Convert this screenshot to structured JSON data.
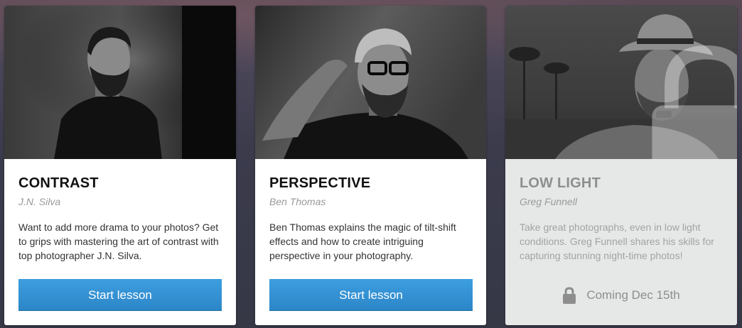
{
  "lessons": [
    {
      "title": "CONTRAST",
      "author": "J.N. Silva",
      "description": "Want to add more drama to your photos? Get to grips with mastering the art of contrast with top photographer J.N. Silva.",
      "action_label": "Start lesson",
      "locked": false,
      "photo_icon": "portrait-photo"
    },
    {
      "title": "PERSPECTIVE",
      "author": "Ben Thomas",
      "description": "Ben Thomas explains the magic of tilt-shift effects and how to create intriguing perspective in your photography.",
      "action_label": "Start lesson",
      "locked": false,
      "photo_icon": "portrait-photo"
    },
    {
      "title": "LOW LIGHT",
      "author": "Greg Funnell",
      "description": "Take great photographs, even in low light conditions. Greg Funnell shares his skills for capturing stunning night-time photos!",
      "status_label": "Coming Dec 15th",
      "locked": true,
      "photo_icon": "portrait-photo",
      "status_icon": "lock-icon"
    }
  ],
  "colors": {
    "button": "#3491d4",
    "locked_card_bg": "#e6e8e8",
    "title_text": "#111111",
    "muted_text": "#999999"
  }
}
